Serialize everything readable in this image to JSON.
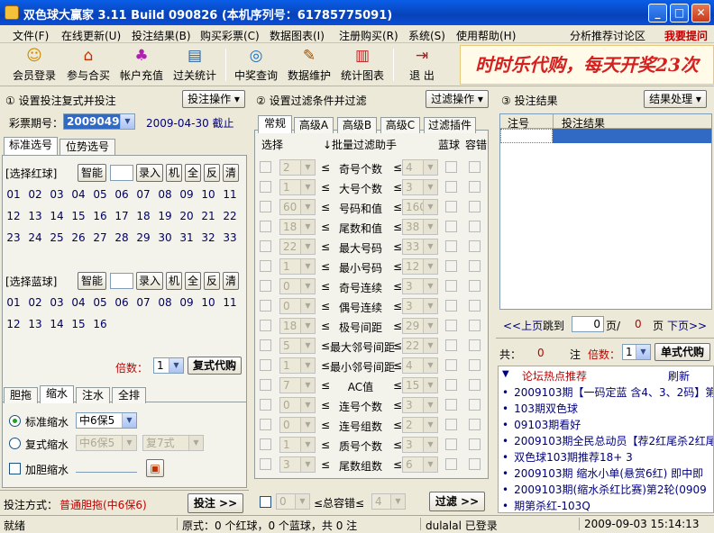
{
  "window": {
    "title": "双色球大赢家 3.11 Build 090826 (本机序列号：61785775091)"
  },
  "menu": [
    "文件(F)",
    "在线更新(U)",
    "投注结果(B)",
    "购买彩票(C)",
    "数据图表(I)",
    "注册购买(R)",
    "系统(S)",
    "使用帮助(H)"
  ],
  "menu_right": {
    "forum": "分析推荐讨论区",
    "help": "我要提问"
  },
  "toolbar": [
    {
      "label": "会员登录",
      "icon": "member-login-icon",
      "glyph": "☺"
    },
    {
      "label": "参与合买",
      "icon": "group-buy-icon",
      "glyph": "⌂"
    },
    {
      "label": "帐户充值",
      "icon": "recharge-icon",
      "glyph": "♣"
    },
    {
      "label": "过关统计",
      "icon": "stats-book-icon",
      "glyph": "▤"
    },
    {
      "label": "中奖查询",
      "icon": "prize-query-icon",
      "glyph": "◎"
    },
    {
      "label": "数据维护",
      "icon": "data-maintain-icon",
      "glyph": "✎"
    },
    {
      "label": "统计图表",
      "icon": "chart-icon",
      "glyph": "▥"
    },
    {
      "label": "退 出",
      "icon": "exit-icon",
      "glyph": "⇥"
    }
  ],
  "banner": "时时乐代购，每天开奖23次",
  "left": {
    "heading": "① 设置投注复式并投注",
    "ops_button": "投注操作 ▾",
    "period_label": "彩票期号：",
    "period_value": "2009049",
    "date_text": "2009-04-30 截止",
    "tabs": [
      "标准选号",
      "位势选号"
    ],
    "red_label": "[选择红球]",
    "blue_label": "[选择蓝球]",
    "tool_buttons": {
      "smart": "智能",
      "input": "录入",
      "machine": "机",
      "all": "全",
      "invert": "反",
      "clear": "清"
    },
    "red_numbers": [
      "01",
      "02",
      "03",
      "04",
      "05",
      "06",
      "07",
      "08",
      "09",
      "10",
      "11",
      "12",
      "13",
      "14",
      "15",
      "16",
      "17",
      "18",
      "19",
      "20",
      "21",
      "22",
      "23",
      "24",
      "25",
      "26",
      "27",
      "28",
      "29",
      "30",
      "31",
      "32",
      "33"
    ],
    "blue_numbers": [
      "01",
      "02",
      "03",
      "04",
      "05",
      "06",
      "07",
      "08",
      "09",
      "10",
      "11",
      "12",
      "13",
      "14",
      "15",
      "16"
    ],
    "multiplier_label": "倍数：",
    "multiplier_value": "1",
    "buy_button": "复式代购",
    "bottom_tabs": [
      "胆拖",
      "缩水",
      "注水",
      "全排"
    ],
    "std_shrink_label": "标准缩水",
    "std_shrink_value": "中6保5",
    "multi_shrink_label": "复式缩水",
    "multi_shrink_value": "中6保5",
    "multi_shrink_value2": "复7式",
    "dan_shrink_label": "加胆缩水",
    "method_label": "投注方式：",
    "method_value": "普通胆拖(中6保6)",
    "bet_button": "投注 >>"
  },
  "middle": {
    "heading": "② 设置过滤条件并过滤",
    "ops_button": "过滤操作 ▾",
    "tabs": [
      "常规",
      "高级A",
      "高级B",
      "高级C",
      "过滤插件"
    ],
    "col_select": "选择",
    "col_batch": "↓批量过滤助手",
    "col_blue": "蓝球",
    "col_tol": "容错",
    "rows": [
      {
        "min": "2",
        "name": "奇号个数",
        "max": "4"
      },
      {
        "min": "1",
        "name": "大号个数",
        "max": "3"
      },
      {
        "min": "60",
        "name": "号码和值",
        "max": "160"
      },
      {
        "min": "18",
        "name": "尾数和值",
        "max": "38"
      },
      {
        "min": "22",
        "name": "最大号码",
        "max": "33"
      },
      {
        "min": "1",
        "name": "最小号码",
        "max": "12"
      },
      {
        "min": "0",
        "name": "奇号连续",
        "max": "3"
      },
      {
        "min": "0",
        "name": "偶号连续",
        "max": "3"
      },
      {
        "min": "18",
        "name": "极号间距",
        "max": "29"
      },
      {
        "min": "5",
        "name": "最大邻号间距",
        "max": "22"
      },
      {
        "min": "1",
        "name": "最小邻号间距",
        "max": "4"
      },
      {
        "min": "7",
        "name": "AC值",
        "max": "15"
      },
      {
        "min": "0",
        "name": "连号个数",
        "max": "3"
      },
      {
        "min": "0",
        "name": "连号组数",
        "max": "2"
      },
      {
        "min": "1",
        "name": "质号个数",
        "max": "3"
      },
      {
        "min": "3",
        "name": "尾数组数",
        "max": "6"
      }
    ],
    "le": "≤",
    "tol_min": "0",
    "tol_label": "≤总容错≤",
    "tol_max": "4",
    "filter_button": "过滤 >>"
  },
  "right": {
    "heading": "③ 投注结果",
    "ops_button": "结果处理 ▾",
    "col_no": "注号",
    "col_result": "投注结果",
    "prev": "<<上页",
    "jump_label": "跳到",
    "page_value": "0",
    "page_sep": "页/",
    "page_total": "0",
    "page_unit": "页",
    "next": "下页>>",
    "total_label": "共：",
    "total_value": "0",
    "bets_unit": "注",
    "mult_label": "倍数：",
    "mult_value": "1",
    "buy_button": "单式代购",
    "forum_title": "论坛热点推荐",
    "refresh": "刷新",
    "forum_items": [
      "2009103期【一码定蓝 含4、3、2码】第1",
      "103期双色球",
      "09103期看好",
      "2009103期全民总动员【荐2红尾杀2红尾】",
      "双色球103期推荐18+ 3",
      "2009103期 缩水小单(悬赏6红) 即中即",
      "2009103期(缩水杀红比赛)第2轮(0909",
      "期第杀红-103Q"
    ]
  },
  "status": {
    "ready": "就绪",
    "formula": "原式：0 个红球，0 个蓝球，共 0 注",
    "user": "dulalal 已登录",
    "time": "2009-09-03 15:14:13"
  },
  "colors": {
    "title": "#0a4fd8",
    "banner": "#d42020",
    "number": "#000060",
    "accent": "#316ac5"
  }
}
